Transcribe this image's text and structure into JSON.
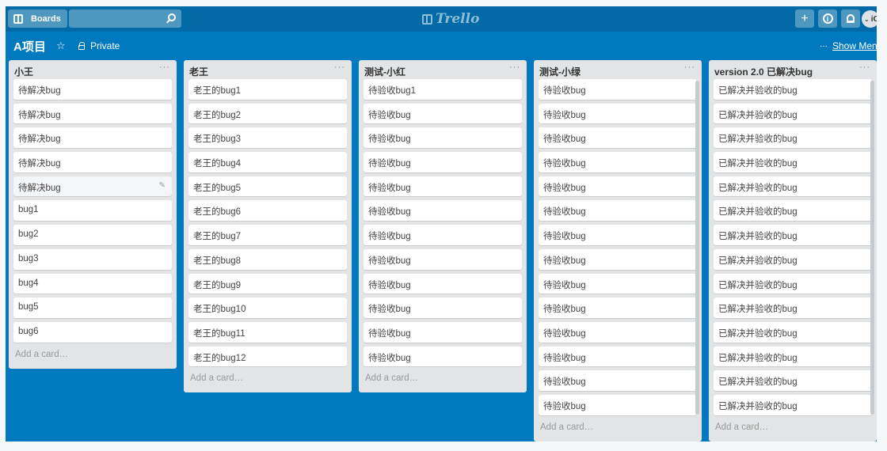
{
  "header": {
    "boards_label": "Boards",
    "search_placeholder": "",
    "logo_text": "Trello",
    "add_label": "+",
    "avatar_text": "iC"
  },
  "board": {
    "title": "A项目",
    "star": "☆",
    "visibility": "Private",
    "menu_dots": "···",
    "show_menu": "Show Menu"
  },
  "lists": [
    {
      "title": "小王",
      "menu": "···",
      "cards": [
        "待解决bug",
        "待解决bug",
        "待解决bug",
        "待解决bug",
        "待解决bug",
        "bug1",
        "bug2",
        "bug3",
        "bug4",
        "bug5",
        "bug6"
      ],
      "add_card": "Add a card…"
    },
    {
      "title": "老王",
      "menu": "···",
      "cards": [
        "老王的bug1",
        "老王的bug2",
        "老王的bug3",
        "老王的bug4",
        "老王的bug5",
        "老王的bug6",
        "老王的bug7",
        "老王的bug8",
        "老王的bug9",
        "老王的bug10",
        "老王的bug11",
        "老王的bug12"
      ],
      "add_card": "Add a card…"
    },
    {
      "title": "测试-小红",
      "menu": "···",
      "cards": [
        "待验收bug1",
        "待验收bug",
        "待验收bug",
        "待验收bug",
        "待验收bug",
        "待验收bug",
        "待验收bug",
        "待验收bug",
        "待验收bug",
        "待验收bug",
        "待验收bug",
        "待验收bug"
      ],
      "add_card": "Add a card…"
    },
    {
      "title": "测试-小绿",
      "menu": "···",
      "cards": [
        "待验收bug",
        "待验收bug",
        "待验收bug",
        "待验收bug",
        "待验收bug",
        "待验收bug",
        "待验收bug",
        "待验收bug",
        "待验收bug",
        "待验收bug",
        "待验收bug",
        "待验收bug",
        "待验收bug",
        "待验收bug"
      ],
      "add_card": "Add a card…"
    },
    {
      "title": "version 2.0 已解决bug",
      "menu": "···",
      "cards": [
        "已解决并验收的bug",
        "已解决并验收的bug",
        "已解决并验收的bug",
        "已解决并验收的bug",
        "已解决并验收的bug",
        "已解决并验收的bug",
        "已解决并验收的bug",
        "已解决并验收的bug",
        "已解决并验收的bug",
        "已解决并验收的bug",
        "已解决并验收的bug",
        "已解决并验收的bug",
        "已解决并验收的bug",
        "已解决并验收的bug"
      ],
      "add_card": "Add a card…"
    }
  ],
  "colors": {
    "board_background": "#0079bf",
    "header_background": "#026aa7",
    "list_background": "#e2e4e6",
    "card_background": "#ffffff"
  }
}
